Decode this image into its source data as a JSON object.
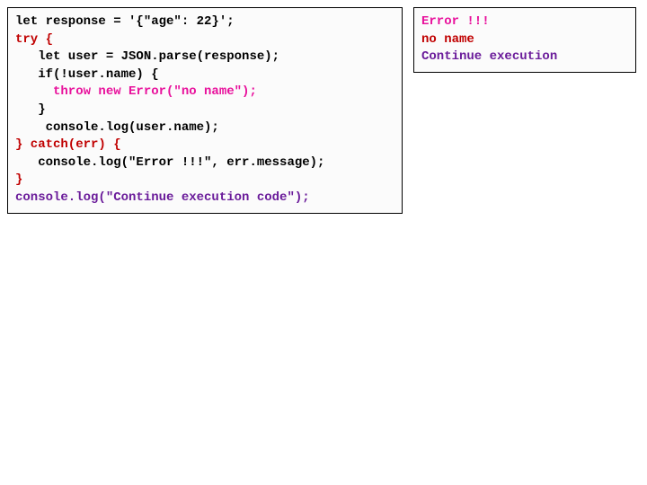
{
  "code": {
    "l1_a": "let response = '{\"age\": 22}';",
    "l2_a": "",
    "l3_a": "try {",
    "l4_a": "   let user = JSON.parse(response);",
    "l5_a": "   if(!user.name) {",
    "l6_a": "     throw new Error(\"no name\");",
    "l7_a": "   }",
    "l8_a": "    console.log(user.name);",
    "l9_a": "} catch(err) {",
    "l10_a": "   console.log(\"Error !!!\", err.message);",
    "l11_a": "}",
    "l12_a": "console.log(\"Continue execution code\");"
  },
  "output": {
    "l1": "Error !!!",
    "l2": "no name",
    "l3": "Continue execution"
  },
  "colors": {
    "red": "#c00000",
    "magenta": "#e8119c",
    "purple": "#6a1b9a",
    "black": "#000000"
  }
}
